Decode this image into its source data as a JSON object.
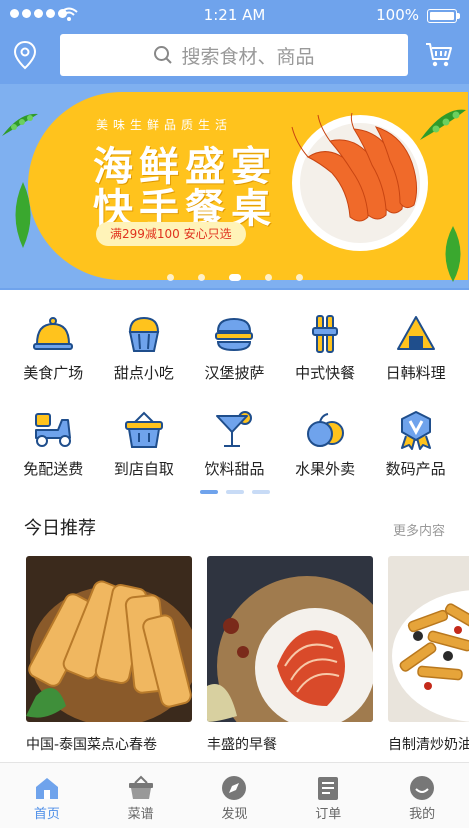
{
  "status_bar": {
    "time": "1:21 AM",
    "battery": "100%"
  },
  "search": {
    "placeholder": "搜索食材、商品"
  },
  "banner": {
    "tagline": "美味生鲜品质生活",
    "title_line1": "海鲜盛宴",
    "title_line2": "快手餐桌",
    "promo": "满299减100 安心只选",
    "slide_count": 5,
    "active_slide": 3
  },
  "categories": {
    "row1": [
      {
        "label": "美食广场",
        "icon": "food-cloche-icon"
      },
      {
        "label": "甜点小吃",
        "icon": "cupcake-icon"
      },
      {
        "label": "汉堡披萨",
        "icon": "burger-icon"
      },
      {
        "label": "中式快餐",
        "icon": "chopsticks-icon"
      },
      {
        "label": "日韩料理",
        "icon": "onigiri-icon"
      }
    ],
    "row2": [
      {
        "label": "免配送费",
        "icon": "scooter-icon"
      },
      {
        "label": "到店自取",
        "icon": "basket-icon"
      },
      {
        "label": "饮料甜品",
        "icon": "cocktail-icon"
      },
      {
        "label": "水果外卖",
        "icon": "fruit-icon"
      },
      {
        "label": "数码产品",
        "icon": "badge-icon"
      }
    ],
    "page_count": 3,
    "active_page": 1
  },
  "recommend": {
    "title": "今日推荐",
    "more": "更多内容",
    "items": [
      {
        "name": "中国-泰国菜点心春卷"
      },
      {
        "name": "丰盛的早餐"
      },
      {
        "name": "自制清炒奶油意面"
      }
    ]
  },
  "tabbar": {
    "items": [
      {
        "label": "首页",
        "icon": "home-icon",
        "active": true
      },
      {
        "label": "菜谱",
        "icon": "basket-icon",
        "active": false
      },
      {
        "label": "发现",
        "icon": "compass-icon",
        "active": false
      },
      {
        "label": "订单",
        "icon": "clipboard-icon",
        "active": false
      },
      {
        "label": "我的",
        "icon": "user-icon",
        "active": false
      }
    ]
  },
  "colors": {
    "primary": "#6fa3ec",
    "accent": "#ffc31d",
    "active_tab": "#4e8fe8"
  }
}
